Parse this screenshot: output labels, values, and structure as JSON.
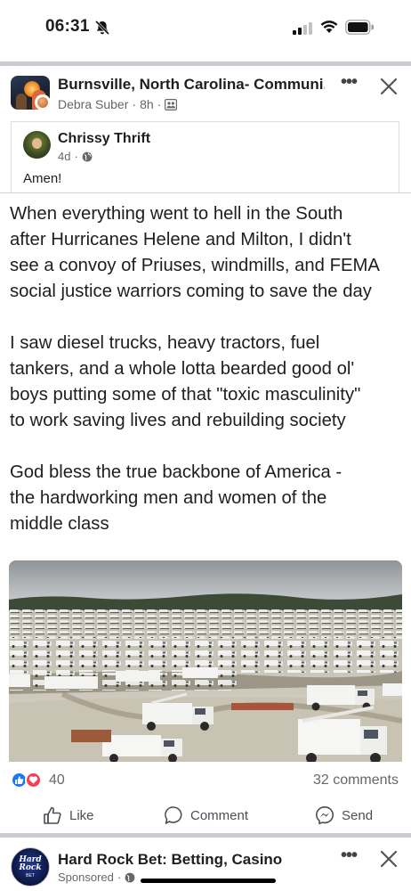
{
  "status_bar": {
    "time": "06:31"
  },
  "post": {
    "group_name": "Burnsville, North Carolina- Communi...",
    "author": "Debra Suber",
    "time": "8h",
    "shared": {
      "name": "Chrissy Thrift",
      "time": "4d",
      "text": "Amen!"
    },
    "paragraphs": [
      [
        "When everything went to hell in the South",
        "after Hurricanes Helene and Milton, I didn't",
        "see a convoy of Priuses, windmills, and FEMA",
        "social justice warriors coming to save the day"
      ],
      [
        "I saw diesel trucks, heavy tractors, fuel",
        "tankers, and a whole lotta bearded good ol'",
        "boys putting some of that \"toxic masculinity\"",
        "to work saving lives and rebuilding society"
      ],
      [
        "God bless the true backbone of America -",
        "the hardworking men and women of the",
        "middle class"
      ]
    ],
    "reaction_count": "40",
    "comments": "32 comments",
    "actions": {
      "like": "Like",
      "comment": "Comment",
      "send": "Send"
    }
  },
  "sponsored": {
    "name": "Hard Rock Bet: Betting, Casino",
    "label": "Sponsored",
    "avatar_text_1": "Hard",
    "avatar_text_2": "Rock",
    "avatar_sub": "BET"
  },
  "icons": {
    "notifications_muted": "bell-slash-icon",
    "audience": "group-members-icon",
    "privacy": "globe-icon",
    "like_reaction": "thumbs-up-icon",
    "love_reaction": "heart-icon"
  },
  "colors": {
    "like_blue": "#1877f2",
    "love_red": "#f33e58",
    "meta_gray": "#65676b"
  }
}
